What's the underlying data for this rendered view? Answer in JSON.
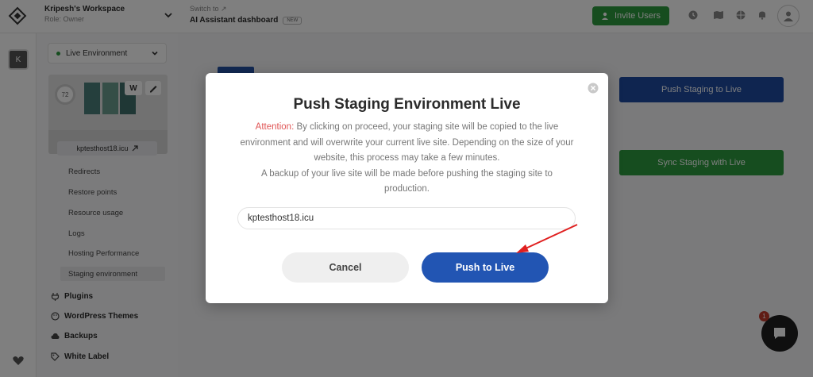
{
  "topbar": {
    "workspace_name": "Kripesh's Workspace",
    "workspace_role": "Role: Owner",
    "switch_label": "Switch to ↗",
    "switch_target": "AI Assistant dashboard",
    "switch_badge": "NEW",
    "invite_label": "Invite Users"
  },
  "rail": {
    "avatar_letter": "K"
  },
  "sidebar": {
    "environment": "Live Environment",
    "score": "72",
    "wp_label": "W",
    "site_domain": "kptesthost18.icu",
    "sub_items": [
      "Redirects",
      "Restore points",
      "Resource usage",
      "Logs",
      "Hosting Performance",
      "Staging environment"
    ],
    "main_items": [
      "Plugins",
      "WordPress Themes",
      "Backups",
      "White Label"
    ]
  },
  "main": {
    "push_staging_label": "Push Staging to Live",
    "sync_staging_label": "Sync Staging with Live"
  },
  "modal": {
    "title": "Push Staging Environment Live",
    "attention": "Attention:",
    "description": " By clicking on proceed, your staging site will be copied to the live environment and will overwrite your current live site. Depending on the size of your website, this process may take a few minutes.",
    "description_2": "A backup of your live site will be made before pushing the staging site to production.",
    "input_value": "kptesthost18.icu",
    "cancel_label": "Cancel",
    "push_label": "Push to Live"
  },
  "chat": {
    "badge": "1"
  },
  "colors": {
    "primary": "#2255b3",
    "success": "#2c9a3e",
    "attention": "#e05555"
  }
}
